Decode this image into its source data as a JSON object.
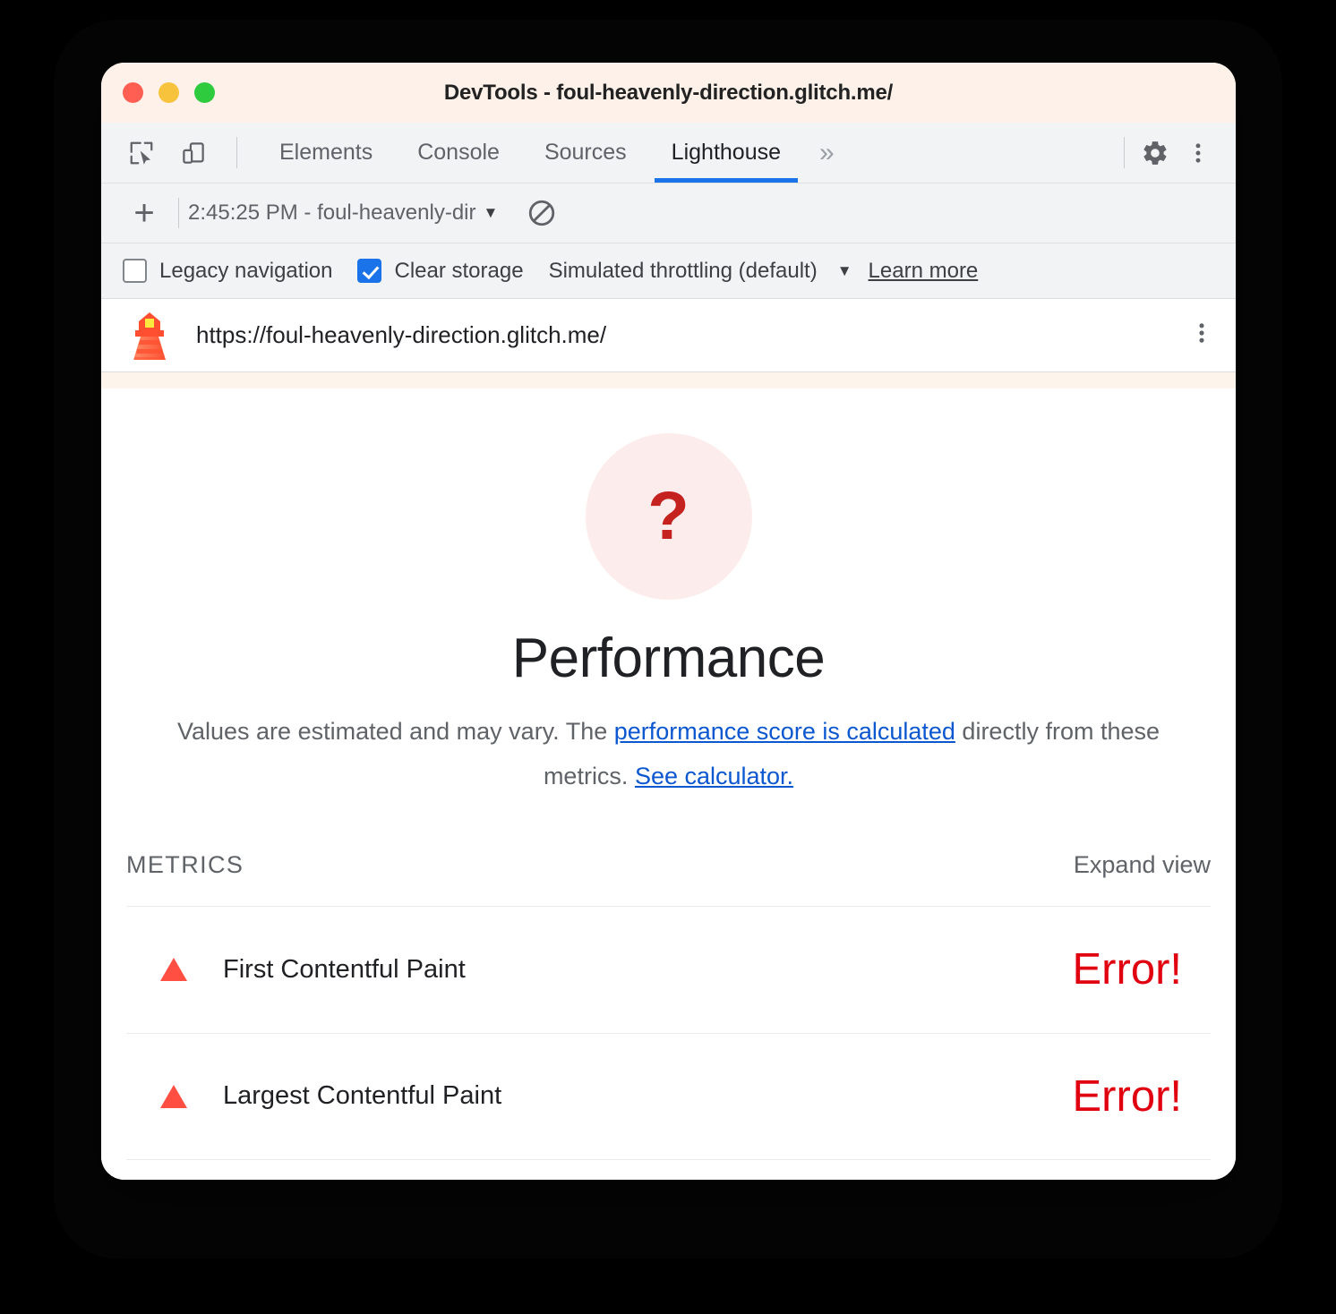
{
  "window": {
    "title": "DevTools - foul-heavenly-direction.glitch.me/",
    "traffic_lights": [
      "close",
      "minimize",
      "maximize"
    ]
  },
  "toolbar": {
    "inspect_icon": "inspect-cursor-icon",
    "device_icon": "device-toolbar-icon",
    "settings_icon": "gear-icon",
    "more_icon": "kebab-menu-icon",
    "overflow_label": "»",
    "tabs": [
      {
        "label": "Elements",
        "active": false
      },
      {
        "label": "Console",
        "active": false
      },
      {
        "label": "Sources",
        "active": false
      },
      {
        "label": "Lighthouse",
        "active": true
      }
    ],
    "active_tab_accent": "#1a73e8"
  },
  "actionbar": {
    "new_report_label": "+",
    "run_selector_value": "2:45:25 PM - foul-heavenly-dir",
    "run_selector_caret": "▼",
    "clear_icon": "no-entry-icon"
  },
  "options": {
    "legacy_navigation": {
      "label": "Legacy navigation",
      "checked": false
    },
    "clear_storage": {
      "label": "Clear storage",
      "checked": true
    },
    "throttling": {
      "label": "Simulated throttling (default)",
      "caret": "▼"
    },
    "learn_more": "Learn more"
  },
  "urlbar": {
    "logo": "lighthouse-logo-icon",
    "url": "https://foul-heavenly-direction.glitch.me/",
    "kebab": "kebab-menu-icon"
  },
  "report": {
    "gauge": {
      "score_symbol": "?",
      "score_color": "#c5221f",
      "background_color": "#fdecec"
    },
    "category_title": "Performance",
    "description": {
      "part1": "Values are estimated and may vary. The ",
      "link1": "performance score is calculated",
      "part2": " directly from these metrics. ",
      "link2": "See calculator."
    },
    "metrics_section_label": "METRICS",
    "expand_view_label": "Expand view",
    "metrics": [
      {
        "icon": "warning-triangle-icon",
        "name": "First Contentful Paint",
        "value": "Error!",
        "status": "error"
      },
      {
        "icon": "warning-triangle-icon",
        "name": "Largest Contentful Paint",
        "value": "Error!",
        "status": "error"
      }
    ]
  },
  "colors": {
    "accent_blue": "#1a73e8",
    "link_blue": "#0b57d0",
    "error_red": "#e1000f",
    "warning_orange": "#ff4e42",
    "titlebar_cream": "#fdf1e9"
  }
}
